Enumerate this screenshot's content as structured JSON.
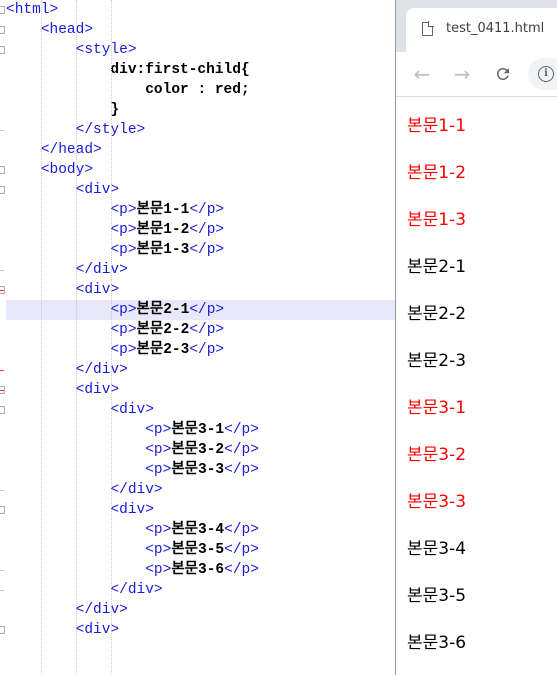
{
  "editor": {
    "lines": [
      [
        {
          "t": "<html>",
          "c": "tag"
        }
      ],
      [
        {
          "t": "    ",
          "c": ""
        },
        {
          "t": "<head>",
          "c": "tag"
        }
      ],
      [
        {
          "t": "        ",
          "c": ""
        },
        {
          "t": "<style>",
          "c": "tag"
        }
      ],
      [
        {
          "t": "            ",
          "c": ""
        },
        {
          "t": "div:first-child{",
          "c": "css"
        }
      ],
      [
        {
          "t": "                ",
          "c": ""
        },
        {
          "t": "color : red;",
          "c": "css"
        }
      ],
      [
        {
          "t": "            ",
          "c": ""
        },
        {
          "t": "}",
          "c": "css"
        }
      ],
      [
        {
          "t": "        ",
          "c": ""
        },
        {
          "t": "</style>",
          "c": "tag"
        }
      ],
      [
        {
          "t": "    ",
          "c": ""
        },
        {
          "t": "</head>",
          "c": "tag"
        }
      ],
      [
        {
          "t": "    ",
          "c": ""
        },
        {
          "t": "<body>",
          "c": "tag"
        }
      ],
      [
        {
          "t": "        ",
          "c": ""
        },
        {
          "t": "<div>",
          "c": "tag"
        }
      ],
      [
        {
          "t": "            ",
          "c": ""
        },
        {
          "t": "<p>",
          "c": "tag"
        },
        {
          "t": "본문1-1",
          "c": "txt"
        },
        {
          "t": "</p>",
          "c": "tag"
        }
      ],
      [
        {
          "t": "            ",
          "c": ""
        },
        {
          "t": "<p>",
          "c": "tag"
        },
        {
          "t": "본문1-2",
          "c": "txt"
        },
        {
          "t": "</p>",
          "c": "tag"
        }
      ],
      [
        {
          "t": "            ",
          "c": ""
        },
        {
          "t": "<p>",
          "c": "tag"
        },
        {
          "t": "본문1-3",
          "c": "txt"
        },
        {
          "t": "</p>",
          "c": "tag"
        }
      ],
      [
        {
          "t": "        ",
          "c": ""
        },
        {
          "t": "</div>",
          "c": "tag"
        }
      ],
      [
        {
          "t": "        ",
          "c": ""
        },
        {
          "t": "<div>",
          "c": "tag"
        }
      ],
      [
        {
          "t": "            ",
          "c": ""
        },
        {
          "t": "<p>",
          "c": "tag"
        },
        {
          "t": "본문2-1",
          "c": "txt"
        },
        {
          "t": "</p>",
          "c": "tag"
        }
      ],
      [
        {
          "t": "            ",
          "c": ""
        },
        {
          "t": "<p>",
          "c": "tag"
        },
        {
          "t": "본문2-2",
          "c": "txt"
        },
        {
          "t": "</p>",
          "c": "tag"
        }
      ],
      [
        {
          "t": "            ",
          "c": ""
        },
        {
          "t": "<p>",
          "c": "tag"
        },
        {
          "t": "본문2-3",
          "c": "txt"
        },
        {
          "t": "</p>",
          "c": "tag"
        }
      ],
      [
        {
          "t": "        ",
          "c": ""
        },
        {
          "t": "</div>",
          "c": "tag"
        }
      ],
      [
        {
          "t": "        ",
          "c": ""
        },
        {
          "t": "<div>",
          "c": "tag"
        }
      ],
      [
        {
          "t": "            ",
          "c": ""
        },
        {
          "t": "<div>",
          "c": "tag"
        }
      ],
      [
        {
          "t": "                ",
          "c": ""
        },
        {
          "t": "<p>",
          "c": "tag"
        },
        {
          "t": "본문3-1",
          "c": "txt"
        },
        {
          "t": "</p>",
          "c": "tag"
        }
      ],
      [
        {
          "t": "                ",
          "c": ""
        },
        {
          "t": "<p>",
          "c": "tag"
        },
        {
          "t": "본문3-2",
          "c": "txt"
        },
        {
          "t": "</p>",
          "c": "tag"
        }
      ],
      [
        {
          "t": "                ",
          "c": ""
        },
        {
          "t": "<p>",
          "c": "tag"
        },
        {
          "t": "본문3-3",
          "c": "txt"
        },
        {
          "t": "</p>",
          "c": "tag"
        }
      ],
      [
        {
          "t": "            ",
          "c": ""
        },
        {
          "t": "</div>",
          "c": "tag"
        }
      ],
      [
        {
          "t": "            ",
          "c": ""
        },
        {
          "t": "<div>",
          "c": "tag"
        }
      ],
      [
        {
          "t": "                ",
          "c": ""
        },
        {
          "t": "<p>",
          "c": "tag"
        },
        {
          "t": "본문3-4",
          "c": "txt"
        },
        {
          "t": "</p>",
          "c": "tag"
        }
      ],
      [
        {
          "t": "                ",
          "c": ""
        },
        {
          "t": "<p>",
          "c": "tag"
        },
        {
          "t": "본문3-5",
          "c": "txt"
        },
        {
          "t": "</p>",
          "c": "tag"
        }
      ],
      [
        {
          "t": "                ",
          "c": ""
        },
        {
          "t": "<p>",
          "c": "tag"
        },
        {
          "t": "본문3-6",
          "c": "txt"
        },
        {
          "t": "</p>",
          "c": "tag"
        }
      ],
      [
        {
          "t": "            ",
          "c": ""
        },
        {
          "t": "</div>",
          "c": "tag"
        }
      ],
      [
        {
          "t": "        ",
          "c": ""
        },
        {
          "t": "</div>",
          "c": "tag"
        }
      ],
      [
        {
          "t": "        ",
          "c": ""
        },
        {
          "t": "<div>",
          "c": "tag"
        }
      ],
      [],
      []
    ],
    "highlighted_line": 15
  },
  "browser": {
    "tab_title": "test_0411.html",
    "icons": {
      "tab": "document-icon",
      "back": "back-arrow-icon",
      "forward": "forward-arrow-icon",
      "reload": "reload-icon",
      "site_info": "info-icon"
    },
    "paragraphs": [
      {
        "text": "본문1-1",
        "color": "#ff0000"
      },
      {
        "text": "본문1-2",
        "color": "#ff0000"
      },
      {
        "text": "본문1-3",
        "color": "#ff0000"
      },
      {
        "text": "본문2-1",
        "color": "#000000"
      },
      {
        "text": "본문2-2",
        "color": "#000000"
      },
      {
        "text": "본문2-3",
        "color": "#000000"
      },
      {
        "text": "본문3-1",
        "color": "#ff0000"
      },
      {
        "text": "본문3-2",
        "color": "#ff0000"
      },
      {
        "text": "본문3-3",
        "color": "#ff0000"
      },
      {
        "text": "본문3-4",
        "color": "#000000"
      },
      {
        "text": "본문3-5",
        "color": "#000000"
      },
      {
        "text": "본문3-6",
        "color": "#000000"
      }
    ]
  },
  "colors": {
    "tag": "#1a1adb",
    "text": "#000000",
    "highlight": "#e8e8fa",
    "red": "#ff0000"
  }
}
